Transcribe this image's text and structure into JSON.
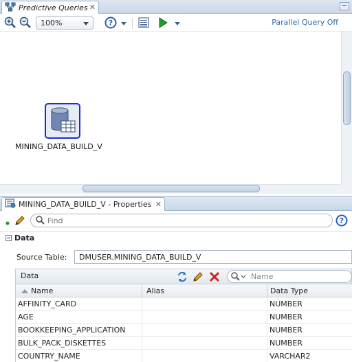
{
  "editor": {
    "tab_title": "Predictive Queries",
    "zoom_level": "100%",
    "parallel_query_status": "Parallel Query Off",
    "node": {
      "label": "MINING_DATA_BUILD_V"
    }
  },
  "properties": {
    "tab_title": "MINING_DATA_BUILD_V - Properties",
    "find_placeholder": "Find",
    "section_title": "Data",
    "source_table_label": "Source Table:",
    "source_table_value": "DMUSER.MINING_DATA_BUILD_V",
    "data_label": "Data",
    "name_filter_placeholder": "Name",
    "columns": [
      "Name",
      "Alias",
      "Data Type"
    ],
    "rows": [
      {
        "name": "AFFINITY_CARD",
        "alias": "",
        "type": "NUMBER"
      },
      {
        "name": "AGE",
        "alias": "",
        "type": "NUMBER"
      },
      {
        "name": "BOOKKEEPING_APPLICATION",
        "alias": "",
        "type": "NUMBER"
      },
      {
        "name": "BULK_PACK_DISKETTES",
        "alias": "",
        "type": "NUMBER"
      },
      {
        "name": "COUNTRY_NAME",
        "alias": "",
        "type": "VARCHAR2"
      }
    ]
  },
  "colors": {
    "accent": "#2e67a8",
    "node_border": "#1c2bd6",
    "run_green": "#1f9a2a",
    "delete_red": "#d22020"
  }
}
